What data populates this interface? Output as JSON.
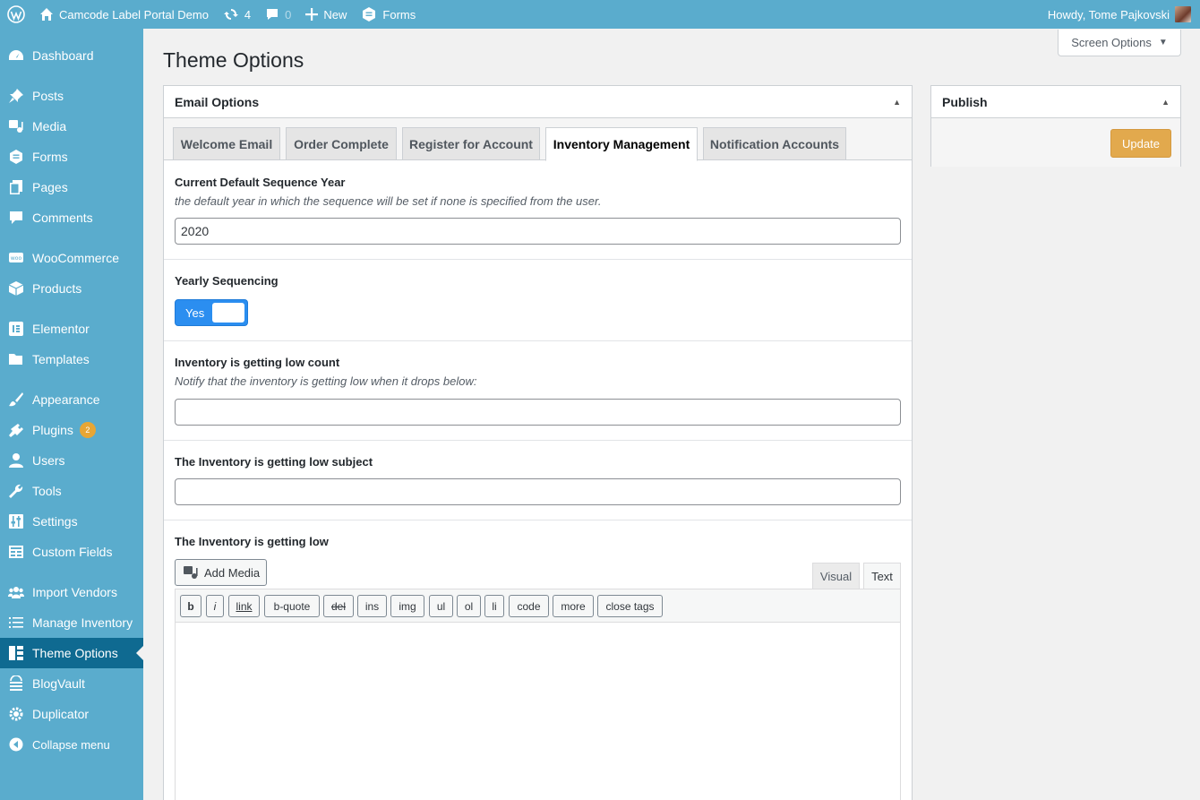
{
  "admin_bar": {
    "site_name": "Camcode Label Portal Demo",
    "updates_count": "4",
    "comments_count": "0",
    "new_label": "New",
    "forms_label": "Forms",
    "howdy": "Howdy, Tome Pajkovski"
  },
  "sidebar": {
    "items": [
      {
        "label": "Dashboard",
        "icon": "dashboard-icon"
      },
      {
        "label": "Posts",
        "icon": "pin-icon"
      },
      {
        "label": "Media",
        "icon": "media-icon"
      },
      {
        "label": "Forms",
        "icon": "forms-icon"
      },
      {
        "label": "Pages",
        "icon": "pages-icon"
      },
      {
        "label": "Comments",
        "icon": "comment-icon"
      },
      {
        "label": "WooCommerce",
        "icon": "woo-icon"
      },
      {
        "label": "Products",
        "icon": "box-icon"
      },
      {
        "label": "Elementor",
        "icon": "elementor-icon"
      },
      {
        "label": "Templates",
        "icon": "folder-icon"
      },
      {
        "label": "Appearance",
        "icon": "brush-icon"
      },
      {
        "label": "Plugins",
        "icon": "plug-icon",
        "badge": "2"
      },
      {
        "label": "Users",
        "icon": "user-icon"
      },
      {
        "label": "Tools",
        "icon": "wrench-icon"
      },
      {
        "label": "Settings",
        "icon": "sliders-icon"
      },
      {
        "label": "Custom Fields",
        "icon": "table-icon"
      },
      {
        "label": "Import Vendors",
        "icon": "groups-icon"
      },
      {
        "label": "Manage Inventory",
        "icon": "list-icon"
      },
      {
        "label": "Theme Options",
        "icon": "layout-icon"
      },
      {
        "label": "BlogVault",
        "icon": "vault-icon"
      },
      {
        "label": "Duplicator",
        "icon": "gear-icon"
      }
    ],
    "collapse_label": "Collapse menu"
  },
  "screen_options": "Screen Options",
  "page_title": "Theme Options",
  "email_options": {
    "title": "Email Options",
    "tabs": [
      "Welcome Email",
      "Order Complete",
      "Register for Account",
      "Inventory Management",
      "Notification Accounts"
    ],
    "active_tab": "Inventory Management",
    "fields": {
      "sequence_year": {
        "label": "Current Default Sequence Year",
        "description": "the default year in which the sequence will be set if none is specified from the user.",
        "value": "2020"
      },
      "yearly_sequencing": {
        "label": "Yearly Sequencing",
        "toggle_label": "Yes"
      },
      "low_count": {
        "label": "Inventory is getting low count",
        "description": "Notify that the inventory is getting low when it drops below:",
        "value": ""
      },
      "low_subject": {
        "label": "The Inventory is getting low subject",
        "value": ""
      },
      "low_body": {
        "label": "The Inventory is getting low",
        "add_media": "Add Media",
        "tab_visual": "Visual",
        "tab_text": "Text",
        "quicktags": [
          "b",
          "i",
          "link",
          "b-quote",
          "del",
          "ins",
          "img",
          "ul",
          "ol",
          "li",
          "code",
          "more",
          "close tags"
        ]
      }
    }
  },
  "publish": {
    "title": "Publish",
    "update_label": "Update"
  },
  "colors": {
    "sidebar": "#5aaccd",
    "current_menu": "#0f6a91",
    "update_button": "#e2a94d",
    "toggle": "#2b8ef0",
    "badge": "#e7a635"
  }
}
